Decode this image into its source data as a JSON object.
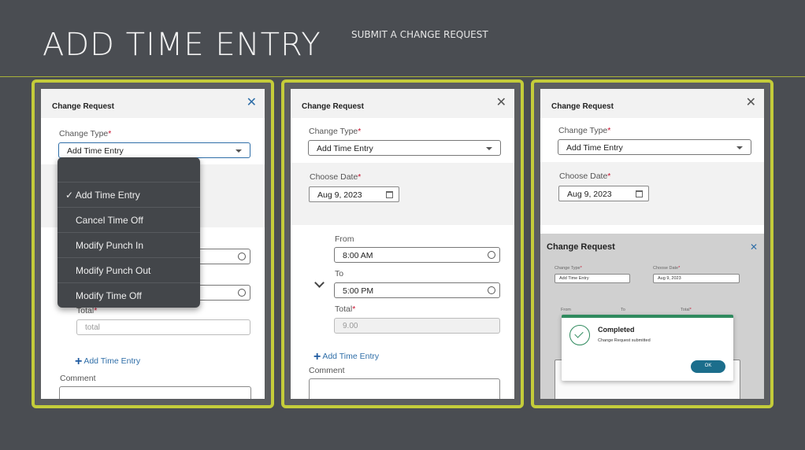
{
  "page": {
    "title": "ADD TIME ENTRY",
    "subtitle": "SUBMIT A CHANGE REQUEST"
  },
  "dialog": {
    "title": "Change Request",
    "change_type_label": "Change Type",
    "change_type_value": "Add Time Entry",
    "choose_date_label": "Choose Date",
    "date_value": "Aug 9, 2023",
    "required_mark": "*",
    "from_label": "From",
    "to_label": "To",
    "total_label": "Total",
    "total_placeholder": "total",
    "from_value": "8:00 AM",
    "to_value": "5:00 PM",
    "total_value": "9.00",
    "add_time_entry": "Add Time Entry",
    "comment_label": "Comment"
  },
  "dropdown": {
    "items": [
      {
        "label": "✓ Add Time Entry",
        "selected": true
      },
      {
        "label": "Cancel Time Off"
      },
      {
        "label": "Modify Punch In"
      },
      {
        "label": "Modify Punch Out"
      },
      {
        "label": "Modify Time Off"
      }
    ]
  },
  "mini": {
    "title": "Change Request",
    "change_type_label": "Change Type",
    "choose_date_label": "Choose Date",
    "change_type_value": "Add Time Entry",
    "date_value": "Aug 9, 2023",
    "from_label": "From",
    "to_label": "To",
    "total_label": "Total"
  },
  "toast": {
    "title": "Completed",
    "message": "Change Request submitted",
    "ok": "OK"
  },
  "icons": {
    "close": "close-icon",
    "calendar": "calendar-icon",
    "clock": "clock-icon",
    "plus": "plus-icon",
    "chevron": "chevron-down-icon",
    "check": "check-icon"
  },
  "colors": {
    "accent": "#2f6ea8",
    "frame": "#c4cc3a",
    "success": "#2f8a5e",
    "required": "#c8102e"
  }
}
